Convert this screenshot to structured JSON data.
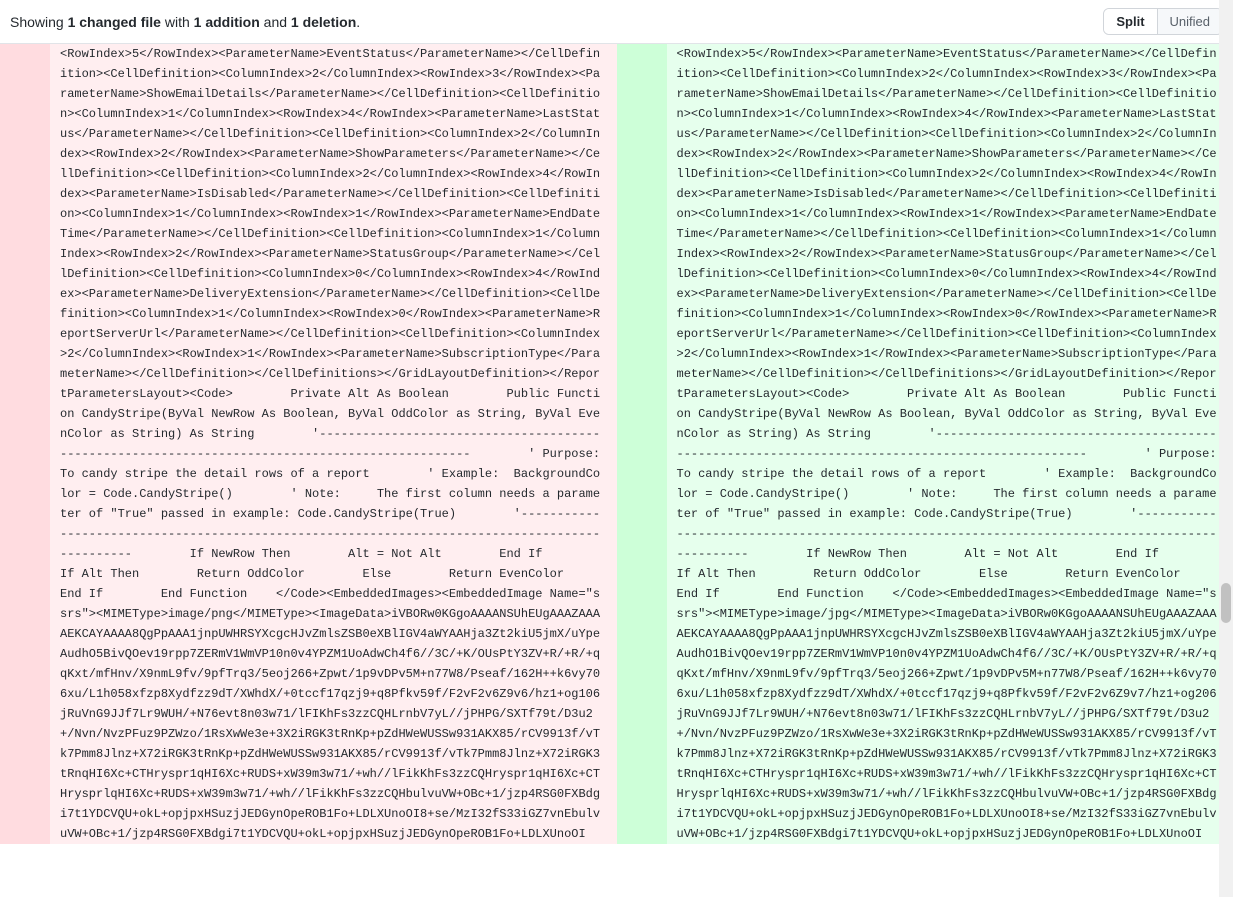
{
  "header": {
    "prefix": "Showing ",
    "changed_files_count": "1 changed file",
    "with": " with ",
    "additions": "1 addition",
    "and": " and ",
    "deletions": "1 deletion",
    "suffix": "."
  },
  "view_toggle": {
    "split": "Split",
    "unified": "Unified"
  },
  "diff": {
    "left": "<RowIndex>5</RowIndex><ParameterName>EventStatus</ParameterName></CellDefinition><CellDefinition><ColumnIndex>2</ColumnIndex><RowIndex>3</RowIndex><ParameterName>ShowEmailDetails</ParameterName></CellDefinition><CellDefinition><ColumnIndex>1</ColumnIndex><RowIndex>4</RowIndex><ParameterName>LastStatus</ParameterName></CellDefinition><CellDefinition><ColumnIndex>2</ColumnIndex><RowIndex>2</RowIndex><ParameterName>ShowParameters</ParameterName></CellDefinition><CellDefinition><ColumnIndex>2</ColumnIndex><RowIndex>4</RowIndex><ParameterName>IsDisabled</ParameterName></CellDefinition><CellDefinition><ColumnIndex>1</ColumnIndex><RowIndex>1</RowIndex><ParameterName>EndDateTime</ParameterName></CellDefinition><CellDefinition><ColumnIndex>1</ColumnIndex><RowIndex>2</RowIndex><ParameterName>StatusGroup</ParameterName></CellDefinition><CellDefinition><ColumnIndex>0</ColumnIndex><RowIndex>4</RowIndex><ParameterName>DeliveryExtension</ParameterName></CellDefinition><CellDefinition><ColumnIndex>1</ColumnIndex><RowIndex>0</RowIndex><ParameterName>ReportServerUrl</ParameterName></CellDefinition><CellDefinition><ColumnIndex>2</ColumnIndex><RowIndex>1</RowIndex><ParameterName>SubscriptionType</ParameterName></CellDefinition></CellDefinitions></GridLayoutDefinition></ReportParametersLayout><Code>        Private Alt As Boolean        Public Function CandyStripe(ByVal NewRow As Boolean, ByVal OddColor as String, ByVal EvenColor as String) As String        '------------------------------------------------------------------------------------------------        ' Purpose:  To candy stripe the detail rows of a report        ' Example:  BackgroundColor = Code.CandyStripe()        ' Note:     The first column needs a parameter of \"True\" passed in example: Code.CandyStripe(True)        '------------------------------------------------------------------------------------------------        If NewRow Then        Alt = Not Alt        End If        If Alt Then        Return OddColor        Else        Return EvenColor        End If        End Function    </Code><EmbeddedImages><EmbeddedImage Name=\"ssrs\"><MIMEType>image/png</MIMEType><ImageData>iVBORw0KGgoAAAANSUhEUgAAAZAAAAEKCAYAAAA8QgPpAAA1jnpUWHRSYXcgcHJvZmlsZSB0eXBlIGV4aWYAAHja3Zt2kiU5jmX/uYpeAudhO5BivQOev19rpp7ZERmV1WmVP10n0v4YPZM1UoAdwCh4f6//3C/+K/OUsPtY3ZV+R/+R/+qqKxt/mfHnv/X9nmL9fv/9pfTrq3/5eoj266+Zpwt/1p9vDPv5M+n77W8/Pseaf/162H++k6vy706xu/L1h058xfzp8Xydfzz9dT/XWhdX/+0tccf17qzj9+q8Pfkv59f/F2vF2v6Z9v6/hz1+og106jRuVnG9JJf7Lr9WUH/+N76evt8n03w71/lFIKhFs3zzCQHLrnbV7yL//jPHPG/SXTf79t/D3u2+/Nvn/NvzPFuz9PZWzo/1RsXwWe3e+3X2iRGK3tRnKp+pZdHWeWUSSw931AKX85/rCV9913f/vTk7Pmm8Jlnz+X72iRGK3tRnKp+pZdHWeWUSSw931AKX85/rCV9913f/vTk7Pmm8Jlnz+X72iRGK3tRnqHI6Xc+CTHryspr1qHI6Xc+RUDS+xW39m3w71/+wh//lFikKhFs3zzCQHryspr1qHI6Xc+CTHrysprlqHI6Xc+RUDS+xW39m3w71/+wh//lFikKhFs3zzCQHbulvuVW+OBc+1/jzp4RSG0FXBdgi7t1YDCVQU+okL+opjpxHSuzjJEDGynOpeROB1Fo+LDLXUnoOI8+se/MzI32fS33iGZ7vnEbulvuVW+OBc+1/jzp4RSG0FXBdgi7t1YDCVQU+okL+opjpxHSuzjJEDGynOpeROB1Fo+LDLXUnoOI",
    "right": "<RowIndex>5</RowIndex><ParameterName>EventStatus</ParameterName></CellDefinition><CellDefinition><ColumnIndex>2</ColumnIndex><RowIndex>3</RowIndex><ParameterName>ShowEmailDetails</ParameterName></CellDefinition><CellDefinition><ColumnIndex>1</ColumnIndex><RowIndex>4</RowIndex><ParameterName>LastStatus</ParameterName></CellDefinition><CellDefinition><ColumnIndex>2</ColumnIndex><RowIndex>2</RowIndex><ParameterName>ShowParameters</ParameterName></CellDefinition><CellDefinition><ColumnIndex>2</ColumnIndex><RowIndex>4</RowIndex><ParameterName>IsDisabled</ParameterName></CellDefinition><CellDefinition><ColumnIndex>1</ColumnIndex><RowIndex>1</RowIndex><ParameterName>EndDateTime</ParameterName></CellDefinition><CellDefinition><ColumnIndex>1</ColumnIndex><RowIndex>2</RowIndex><ParameterName>StatusGroup</ParameterName></CellDefinition><CellDefinition><ColumnIndex>0</ColumnIndex><RowIndex>4</RowIndex><ParameterName>DeliveryExtension</ParameterName></CellDefinition><CellDefinition><ColumnIndex>1</ColumnIndex><RowIndex>0</RowIndex><ParameterName>ReportServerUrl</ParameterName></CellDefinition><CellDefinition><ColumnIndex>2</ColumnIndex><RowIndex>1</RowIndex><ParameterName>SubscriptionType</ParameterName></CellDefinition></CellDefinitions></GridLayoutDefinition></ReportParametersLayout><Code>        Private Alt As Boolean        Public Function CandyStripe(ByVal NewRow As Boolean, ByVal OddColor as String, ByVal EvenColor as String) As String        '------------------------------------------------------------------------------------------------        ' Purpose:  To candy stripe the detail rows of a report        ' Example:  BackgroundColor = Code.CandyStripe()        ' Note:     The first column needs a parameter of \"True\" passed in example: Code.CandyStripe(True)        '------------------------------------------------------------------------------------------------        If NewRow Then        Alt = Not Alt        End If        If Alt Then        Return OddColor        Else        Return EvenColor        End If        End Function    </Code><EmbeddedImages><EmbeddedImage Name=\"ssrs\"><MIMEType>image/jpg</MIMEType><ImageData>iVBORw0KGgoAAAANSUhEUgAAAZAAAAEKCAYAAAA8QgPpAAA1jnpUWHRSYXcgcHJvZmlsZSB0eXBlIGV4aWYAAHja3Zt2kiU5jmX/uYpeAudhO1BivQOev19rpp7ZERmV1WmVP10n0v4YPZM1UoAdwCh4f6//3C/+K/OUsPtY3ZV+R/+R/+qqKxt/mfHnv/X9nmL9fv/9pfTrq3/5eoj266+Zpwt/1p9vDPv5M+n77W8/Pseaf/162H++k6vy706xu/L1h058xfzp8Xydfzz9dT/XWhdX/+0tccf17qzj9+q8Pfkv59f/F2vF2v6Z9v7/hz1+og206jRuVnG9JJf7Lr9WUH/+N76evt8n03w71/lFIKhFs3zzCQHLrnbV7yL//jPHPG/SXTf79t/D3u2+/Nvn/NvzPFuz9PZWzo/1RsXwWe3e+3X2iRGK3tRnKp+pZdHWeWUSSw931AKX85/rCV9913f/vTk7Pmm8Jlnz+X72iRGK3tRnKp+pZdHWeWUSSw931AKX85/rCV9913f/vTk7Pmm8Jlnz+X72iRGK3tRnqHI6Xc+CTHryspr1qHI6Xc+RUDS+xW39m3w71/+wh//lFikKhFs3zzCQHryspr1qHI6Xc+CTHrysprlqHI6Xc+RUDS+xW39m3w71/+wh//lFikKhFs3zzCQHbulvuVW+OBc+1/jzp4RSG0FXBdgi7t1YDCVQU+okL+opjpxHSuzjJEDGynOpeROB1Fo+LDLXUnoOI8+se/MzI32fS33iGZ7vnEbulvuVW+OBc+1/jzp4RSG0FXBdgi7t1YDCVQU+okL+opjpxHSuzjJEDGynOpeROB1Fo+LDLXUnoOI"
  }
}
